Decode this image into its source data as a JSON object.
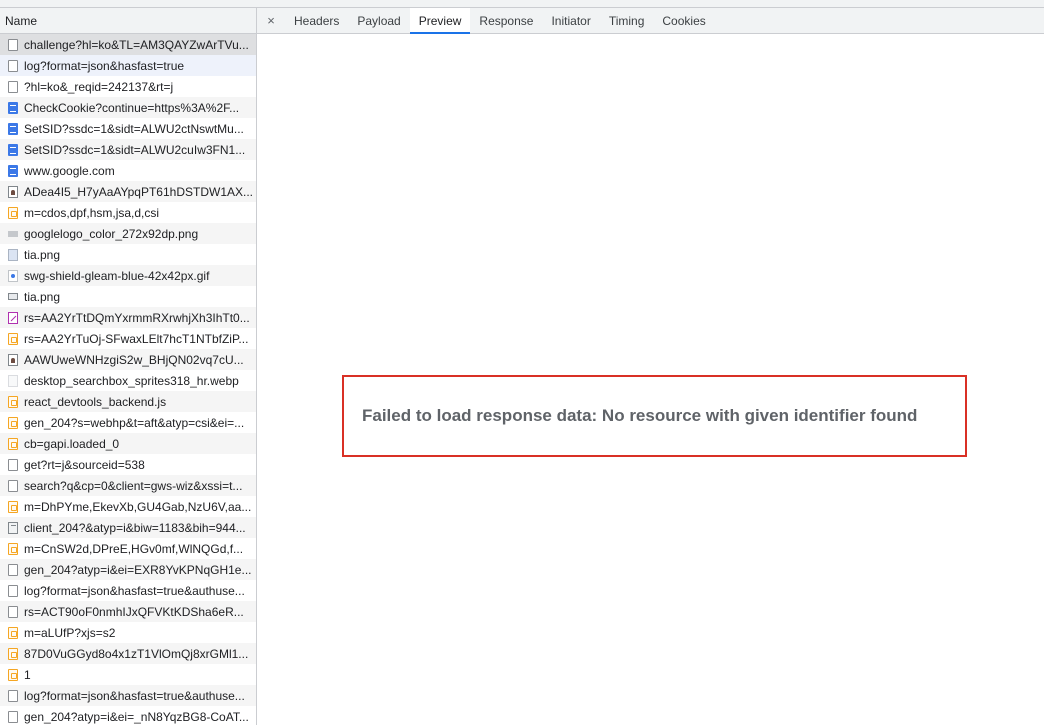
{
  "requests_panel": {
    "header": "Name",
    "requests": [
      {
        "name": "challenge?hl=ko&TL=AM3QAYZwArTVu...",
        "icon": "document-icon",
        "state": "selected"
      },
      {
        "name": "log?format=json&hasfast=true",
        "icon": "document-icon",
        "state": "hovered"
      },
      {
        "name": "?hl=ko&_reqid=242137&rt=j",
        "icon": "document-icon",
        "state": ""
      },
      {
        "name": "CheckCookie?continue=https%3A%2F...",
        "icon": "html-document-icon",
        "state": ""
      },
      {
        "name": "SetSID?ssdc=1&sidt=ALWU2ctNswtMu...",
        "icon": "html-document-icon",
        "state": ""
      },
      {
        "name": "SetSID?ssdc=1&sidt=ALWU2cuIw3FN1...",
        "icon": "html-document-icon",
        "state": ""
      },
      {
        "name": "www.google.com",
        "icon": "html-document-icon",
        "state": ""
      },
      {
        "name": "ADea4I5_H7yAaAYpqPT61hDSTDW1AX...",
        "icon": "image-avatar-icon",
        "state": ""
      },
      {
        "name": "m=cdos,dpf,hsm,jsa,d,csi",
        "icon": "script-icon",
        "state": ""
      },
      {
        "name": "googlelogo_color_272x92dp.png",
        "icon": "png-image-icon",
        "state": ""
      },
      {
        "name": "tia.png",
        "icon": "image-icon",
        "state": ""
      },
      {
        "name": "swg-shield-gleam-blue-42x42px.gif",
        "icon": "gif-image-icon",
        "state": ""
      },
      {
        "name": "tia.png",
        "icon": "png-thumbnail-icon",
        "state": ""
      },
      {
        "name": "rs=AA2YrTtDQmYxrmmRXrwhjXh3IhTt0...",
        "icon": "font-icon",
        "state": ""
      },
      {
        "name": "rs=AA2YrTuOj-SFwaxLElt7hcT1NTbfZiP...",
        "icon": "script-icon",
        "state": ""
      },
      {
        "name": "AAWUweWNHzgiS2w_BHjQN02vq7cU...",
        "icon": "image-avatar-icon",
        "state": ""
      },
      {
        "name": "desktop_searchbox_sprites318_hr.webp",
        "icon": "webp-image-icon",
        "state": ""
      },
      {
        "name": "react_devtools_backend.js",
        "icon": "script-icon",
        "state": ""
      },
      {
        "name": "gen_204?s=webhp&t=aft&atyp=csi&ei=...",
        "icon": "script-icon",
        "state": ""
      },
      {
        "name": "cb=gapi.loaded_0",
        "icon": "script-icon",
        "state": ""
      },
      {
        "name": "get?rt=j&sourceid=538",
        "icon": "document-icon",
        "state": ""
      },
      {
        "name": "search?q&cp=0&client=gws-wiz&xssi=t...",
        "icon": "document-icon",
        "state": ""
      },
      {
        "name": "m=DhPYme,EkevXb,GU4Gab,NzU6V,aa...",
        "icon": "script-icon",
        "state": ""
      },
      {
        "name": "client_204?&atyp=i&biw=1183&bih=944...",
        "icon": "frame-icon",
        "state": ""
      },
      {
        "name": "m=CnSW2d,DPreE,HGv0mf,WlNQGd,f...",
        "icon": "script-icon",
        "state": ""
      },
      {
        "name": "gen_204?atyp=i&ei=EXR8YvKPNqGH1e...",
        "icon": "document-icon",
        "state": ""
      },
      {
        "name": "log?format=json&hasfast=true&authuse...",
        "icon": "document-icon",
        "state": ""
      },
      {
        "name": "rs=ACT90oF0nmhIJxQFVKtKDSha6eR...",
        "icon": "document-icon",
        "state": ""
      },
      {
        "name": "m=aLUfP?xjs=s2",
        "icon": "script-icon",
        "state": ""
      },
      {
        "name": "87D0VuGGyd8o4x1zT1VlOmQj8xrGMl1...",
        "icon": "script-icon",
        "state": ""
      },
      {
        "name": "1",
        "icon": "script-icon",
        "state": ""
      },
      {
        "name": "log?format=json&hasfast=true&authuse...",
        "icon": "document-icon",
        "state": ""
      },
      {
        "name": "gen_204?atyp=i&ei=_nN8YqzBG8-CoAT...",
        "icon": "document-icon",
        "state": ""
      }
    ]
  },
  "detail_panel": {
    "close_glyph": "×",
    "tabs": [
      {
        "label": "Headers",
        "id": "headers"
      },
      {
        "label": "Payload",
        "id": "payload"
      },
      {
        "label": "Preview",
        "id": "preview",
        "active": true
      },
      {
        "label": "Response",
        "id": "response"
      },
      {
        "label": "Initiator",
        "id": "initiator"
      },
      {
        "label": "Timing",
        "id": "timing"
      },
      {
        "label": "Cookies",
        "id": "cookies"
      }
    ],
    "error_message": "Failed to load response data: No resource with given identifier found",
    "error_border_color": "#d93025"
  }
}
